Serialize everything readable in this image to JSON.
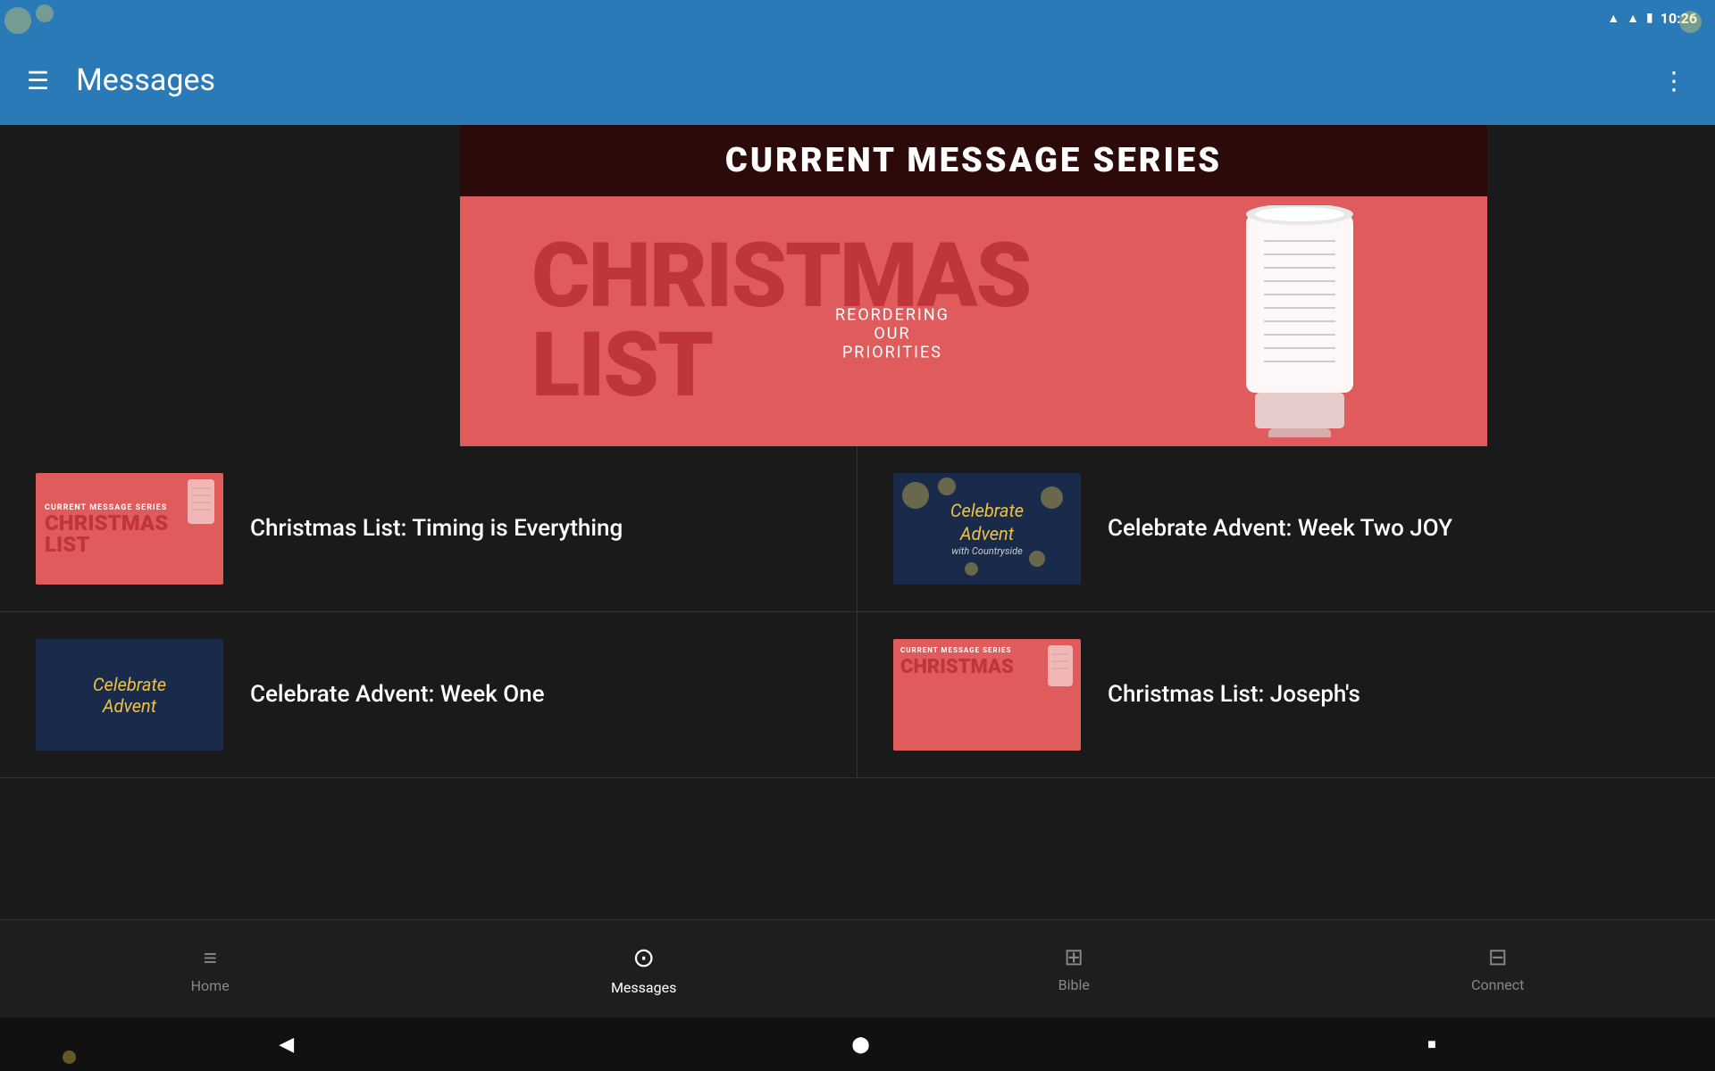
{
  "statusBar": {
    "time": "10:26",
    "icons": [
      "wifi",
      "signal",
      "battery"
    ]
  },
  "appBar": {
    "menuIcon": "☰",
    "title": "Messages",
    "moreIcon": "⋮"
  },
  "hero": {
    "titleText": "CURRENT MESSAGE SERIES",
    "seriesName": "CHRISTMAS LIST",
    "reorderingLine1": "REORDERING",
    "reorderingLine2": "OUR",
    "reorderingLine3": "PRIORITIES"
  },
  "sermons": [
    {
      "id": 1,
      "title": "Christmas List: Timing is Everything",
      "thumbnailType": "christmas-list"
    },
    {
      "id": 2,
      "title": "Celebrate Advent: Week Two JOY",
      "thumbnailType": "advent"
    },
    {
      "id": 3,
      "title": "Celebrate Advent: Week One",
      "thumbnailType": "advent2"
    },
    {
      "id": 4,
      "title": "Christmas List: Joseph's",
      "thumbnailType": "christmas2"
    }
  ],
  "nav": {
    "items": [
      {
        "id": "home",
        "label": "Home",
        "icon": "≡",
        "active": false
      },
      {
        "id": "messages",
        "label": "Messages",
        "icon": "▶",
        "active": true
      },
      {
        "id": "bible",
        "label": "Bible",
        "icon": "✚",
        "active": false
      },
      {
        "id": "connect",
        "label": "Connect",
        "icon": "▦",
        "active": false
      }
    ]
  },
  "sysNav": {
    "back": "◀",
    "home": "⬤",
    "recent": "■"
  }
}
